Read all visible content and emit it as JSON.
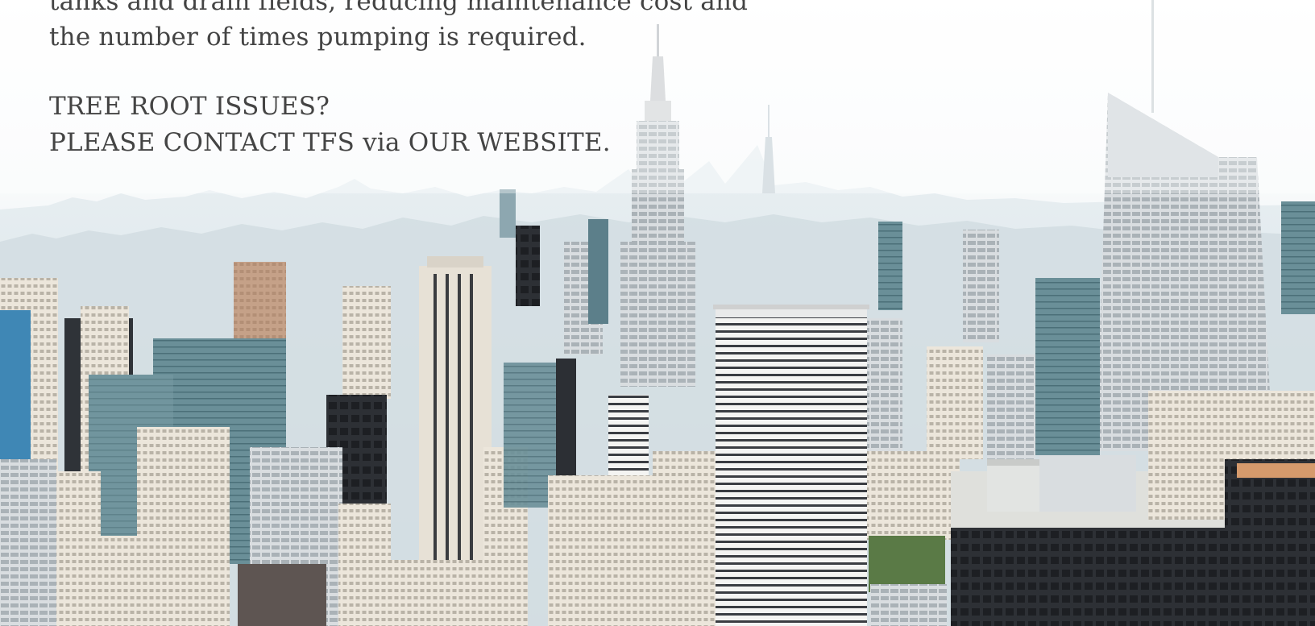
{
  "intro": {
    "line1": "tanks and drain fields, reducing maintenance cost and",
    "line2": "the number of times pumping is required."
  },
  "cta": {
    "heading": "TREE ROOT ISSUES?",
    "contact": "PLEASE CONTACT TFS via OUR WEBSITE."
  },
  "colors": {
    "text": "#444444",
    "sky": "#f7f9fa",
    "haze": "#dbe6ea",
    "building_light": "#e9e3d8",
    "building_dark": "#2b2e33",
    "glass": "#5d8a94"
  }
}
